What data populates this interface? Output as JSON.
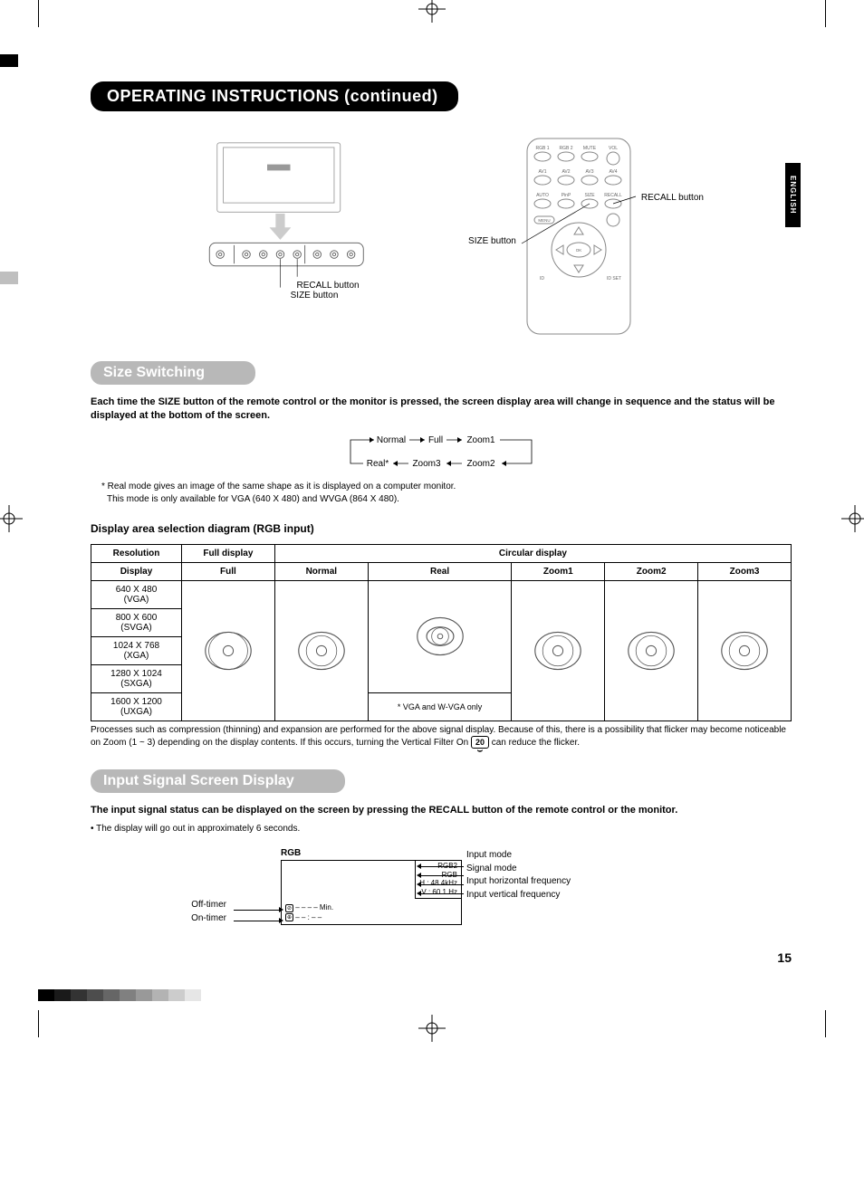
{
  "page_title": "OPERATING INSTRUCTIONS (continued)",
  "language_tab": "ENGLISH",
  "page_number": "15",
  "callouts": {
    "recall_button": "RECALL button",
    "size_button": "SIZE button"
  },
  "remote_buttons": [
    "RGB 1",
    "RGB 2",
    "MUTE",
    "VOL",
    "AV1",
    "AV2",
    "AV3",
    "AV4",
    "AUTO",
    "PinP",
    "SIZE",
    "RECALL",
    "MENU",
    "OK",
    "ID",
    "ID SET"
  ],
  "section1": {
    "heading": "Size Switching",
    "intro": "Each time the SIZE button of the remote control or the monitor is pressed, the screen display area will change in sequence and the status will be displayed at the bottom of the screen.",
    "flow": [
      "Normal",
      "Full",
      "Zoom1",
      "Zoom2",
      "Zoom3",
      "Real*"
    ],
    "footnote_1": "* Real mode gives an image of the same shape as it is displayed on a computer monitor.",
    "footnote_2": "This mode is only available for VGA (640 X 480) and WVGA (864 X 480).",
    "subhead": "Display area selection diagram (RGB input)",
    "table": {
      "header1": [
        "Resolution",
        "Full display",
        "Circular display"
      ],
      "header2": [
        "Display",
        "Full",
        "Normal",
        "Real",
        "Zoom1",
        "Zoom2",
        "Zoom3"
      ],
      "rows": [
        {
          "res": "640 X 480",
          "label": "(VGA)"
        },
        {
          "res": "800 X 600",
          "label": "(SVGA)"
        },
        {
          "res": "1024 X 768",
          "label": "(XGA)"
        },
        {
          "res": "1280 X 1024",
          "label": "(SXGA)"
        },
        {
          "res": "1600 X 1200",
          "label": "(UXGA)"
        }
      ],
      "real_note": "* VGA and W-VGA only"
    },
    "table_note_pre": "Processes such as compression (thinning) and expansion are performed for the above signal display. Because of this, there is a possibility that flicker may become noticeable on Zoom (1 ~ 3) depending on the display contents. If this occurs, turning the Vertical Filter On",
    "table_note_ref": "20",
    "table_note_post": " can reduce the flicker."
  },
  "section2": {
    "heading": "Input Signal Screen Display",
    "intro": "The input signal status can be displayed on the screen by pressing the RECALL button of the remote control or the monitor.",
    "bullet": "• The display will go out in approximately 6 seconds.",
    "rgb_label": "RGB",
    "osd": {
      "line1": "RGB2",
      "line2": "RGB",
      "line3": "H :   48.4kHz",
      "line4": "V :   60.1  Hz"
    },
    "timer_min": "– –   – – Min.",
    "timer_time": "– – : – –",
    "labels_right": [
      "Input mode",
      "Signal mode",
      "Input horizontal frequency",
      "Input vertical frequency"
    ],
    "labels_left": [
      "Off-timer",
      "On-timer"
    ]
  }
}
